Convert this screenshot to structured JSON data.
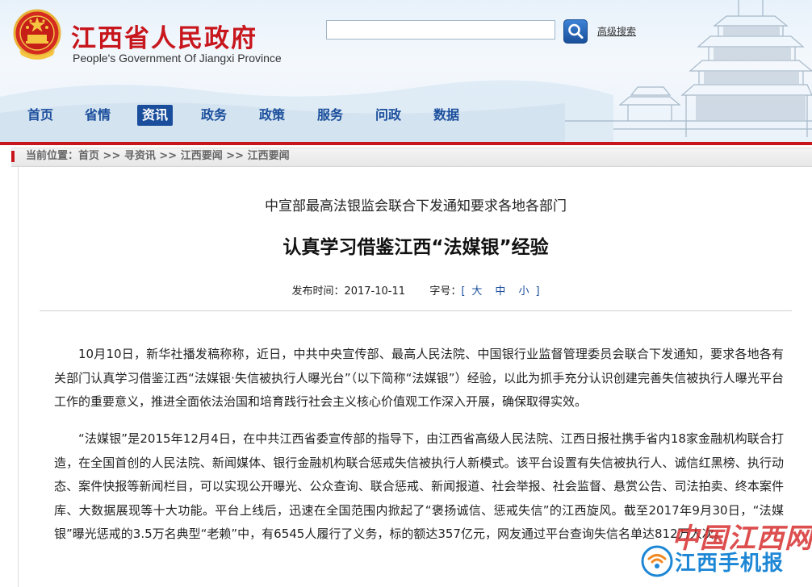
{
  "header": {
    "site_title": "江西省人民政府",
    "site_subtitle": "People's Government Of Jiangxi Province",
    "search_placeholder": "",
    "advanced_search": "高级搜索"
  },
  "nav": {
    "items": [
      {
        "label": "首页",
        "active": false
      },
      {
        "label": "省情",
        "active": false
      },
      {
        "label": "资讯",
        "active": true
      },
      {
        "label": "政务",
        "active": false
      },
      {
        "label": "政策",
        "active": false
      },
      {
        "label": "服务",
        "active": false
      },
      {
        "label": "问政",
        "active": false
      },
      {
        "label": "数据",
        "active": false
      }
    ]
  },
  "breadcrumb": {
    "prefix": "当前位置：",
    "items": [
      "首页",
      "寻资讯",
      "江西要闻",
      "江西要闻"
    ],
    "separator": " >> "
  },
  "article": {
    "lead_title": "中宣部最高法银监会联合下发通知要求各地各部门",
    "main_title": "认真学习借鉴江西“法媒银”经验",
    "published_label": "发布时间：",
    "published_date": "2017-10-11",
    "font_size_label": "字号：",
    "font_size_open": "[",
    "font_size_options": [
      "大",
      "中",
      "小"
    ],
    "font_size_close": "]",
    "paragraphs": [
      "10月10日，新华社播发稿称称，近日，中共中央宣传部、最高人民法院、中国银行业监督管理委员会联合下发通知，要求各地各有关部门认真学习借鉴江西“法媒银·失信被执行人曝光台”（以下简称“法媒银”）经验，以此为抓手充分认识创建完善失信被执行人曝光平台工作的重要意义，推进全面依法治国和培育践行社会主义核心价值观工作深入开展，确保取得实效。",
      "“法媒银”是2015年12月4日，在中共江西省委宣传部的指导下，由江西省高级人民法院、江西日报社携手省内18家金融机构联合打造，在全国首创的人民法院、新闻媒体、银行金融机构联合惩戒失信被执行人新模式。该平台设置有失信被执行人、诚信红黑榜、执行动态、案件快报等新闻栏目，可以实现公开曝光、公众查询、联合惩戒、新闻报道、社会举报、社会监督、悬赏公告、司法拍卖、终本案件库、大数据展现等十大功能。平台上线后，迅速在全国范围内掀起了“褒扬诚信、惩戒失信”的江西旋风。截至2017年9月30日，“法媒银”曝光惩戒的3.5万名典型“老赖”中，有6545人履行了义务，标的额达357亿元，网友通过平台查询失信名单达812万人次。"
    ]
  },
  "watermark": {
    "script_text": "中国江西网",
    "label": "江西手机报"
  },
  "colors": {
    "brand_red": "#c8161d",
    "nav_blue": "#1a4e9c",
    "watermark_blue": "#1d87d6"
  }
}
